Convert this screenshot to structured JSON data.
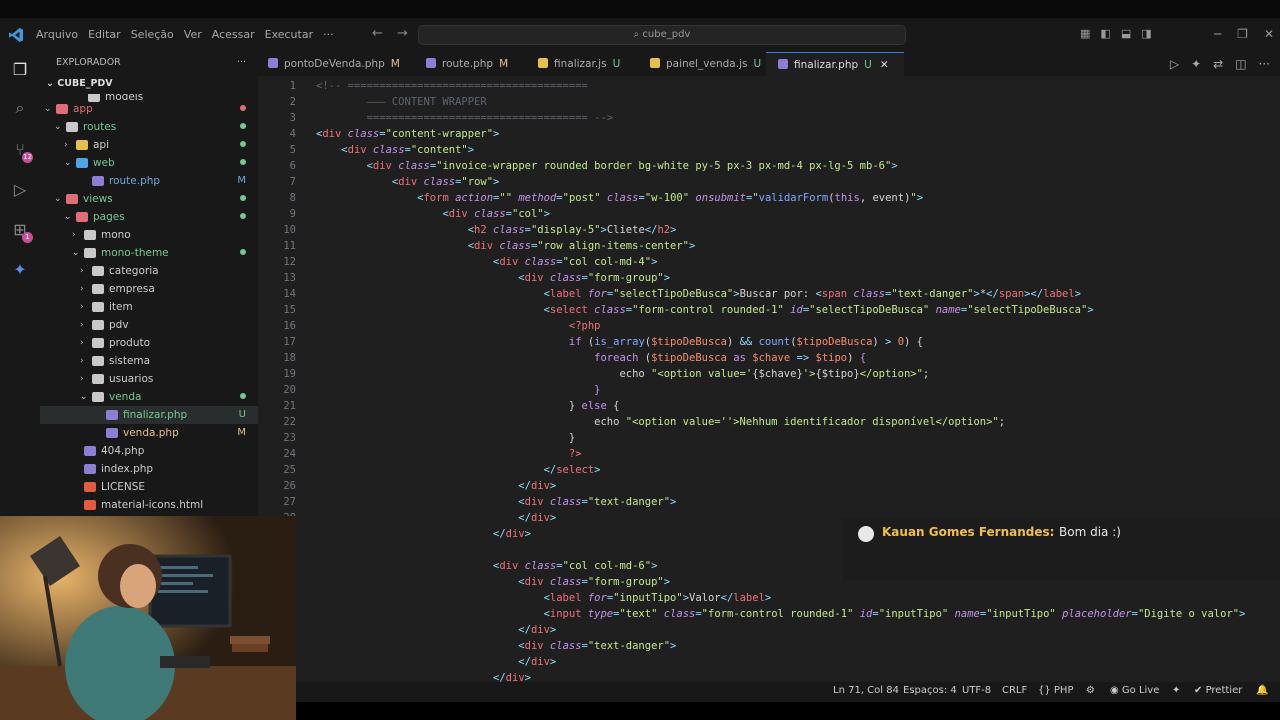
{
  "menu": [
    "Arquivo",
    "Editar",
    "Seleção",
    "Ver",
    "Acessar",
    "Executar",
    "···"
  ],
  "search": "cube_pdv",
  "sidebar": {
    "title": "EXPLORADOR",
    "root": "CUBE_PDV",
    "items": [
      {
        "label": "models",
        "status": "",
        "color": "#ccc"
      },
      {
        "label": "app",
        "status": "dot",
        "color": "#e06c75"
      },
      {
        "label": "routes",
        "status": "dot",
        "color": "#73c991"
      },
      {
        "label": "api",
        "status": "dot",
        "color": "#ccc"
      },
      {
        "label": "web",
        "status": "dot",
        "color": "#73c991"
      },
      {
        "label": "route.php",
        "status": "M",
        "color": "#73a6d9"
      },
      {
        "label": "views",
        "status": "dot",
        "color": "#73c991"
      },
      {
        "label": "pages",
        "status": "dot",
        "color": "#73c991"
      },
      {
        "label": "mono",
        "status": "",
        "color": "#ccc"
      },
      {
        "label": "mono-theme",
        "status": "dot",
        "color": "#73c991"
      },
      {
        "label": "categoria",
        "status": "",
        "color": "#ccc"
      },
      {
        "label": "empresa",
        "status": "",
        "color": "#ccc"
      },
      {
        "label": "item",
        "status": "",
        "color": "#ccc"
      },
      {
        "label": "pdv",
        "status": "",
        "color": "#ccc"
      },
      {
        "label": "produto",
        "status": "",
        "color": "#ccc"
      },
      {
        "label": "sistema",
        "status": "",
        "color": "#ccc"
      },
      {
        "label": "usuarios",
        "status": "",
        "color": "#ccc"
      },
      {
        "label": "venda",
        "status": "dot",
        "color": "#73c991"
      },
      {
        "label": "finalizar.php",
        "status": "U",
        "color": "#73c991"
      },
      {
        "label": "venda.php",
        "status": "M",
        "color": "#e2c08d"
      },
      {
        "label": "404.php",
        "status": "",
        "color": "#ccc"
      },
      {
        "label": "index.php",
        "status": "",
        "color": "#ccc"
      },
      {
        "label": "LICENSE",
        "status": "",
        "color": "#ccc"
      },
      {
        "label": "material-icons.html",
        "status": "",
        "color": "#ccc"
      }
    ]
  },
  "tabs": [
    {
      "label": "pontoDeVenda.php",
      "mod": "M"
    },
    {
      "label": "route.php",
      "mod": "M"
    },
    {
      "label": "finalizar.js",
      "mod": "U"
    },
    {
      "label": "painel_venda.js",
      "mod": "U"
    },
    {
      "label": "finalizar.php",
      "mod": "U"
    }
  ],
  "lines": [
    "1",
    "2",
    "3",
    "4",
    "5",
    "6",
    "7",
    "8",
    "9",
    "10",
    "11",
    "12",
    "13",
    "14",
    "15",
    "16",
    "17",
    "18",
    "19",
    "20",
    "21",
    "22",
    "23",
    "24",
    "25",
    "26",
    "27",
    "28"
  ],
  "chat": {
    "name": "Kauan Gomes Fernandes:",
    "message": "Bom dia :)"
  },
  "status": {
    "position": "Ln 71, Col 84",
    "spaces": "Espaços: 4",
    "encoding": "UTF-8",
    "eol": "CRLF",
    "language": "PHP",
    "golive": "Go Live",
    "prettier": "Prettier"
  }
}
